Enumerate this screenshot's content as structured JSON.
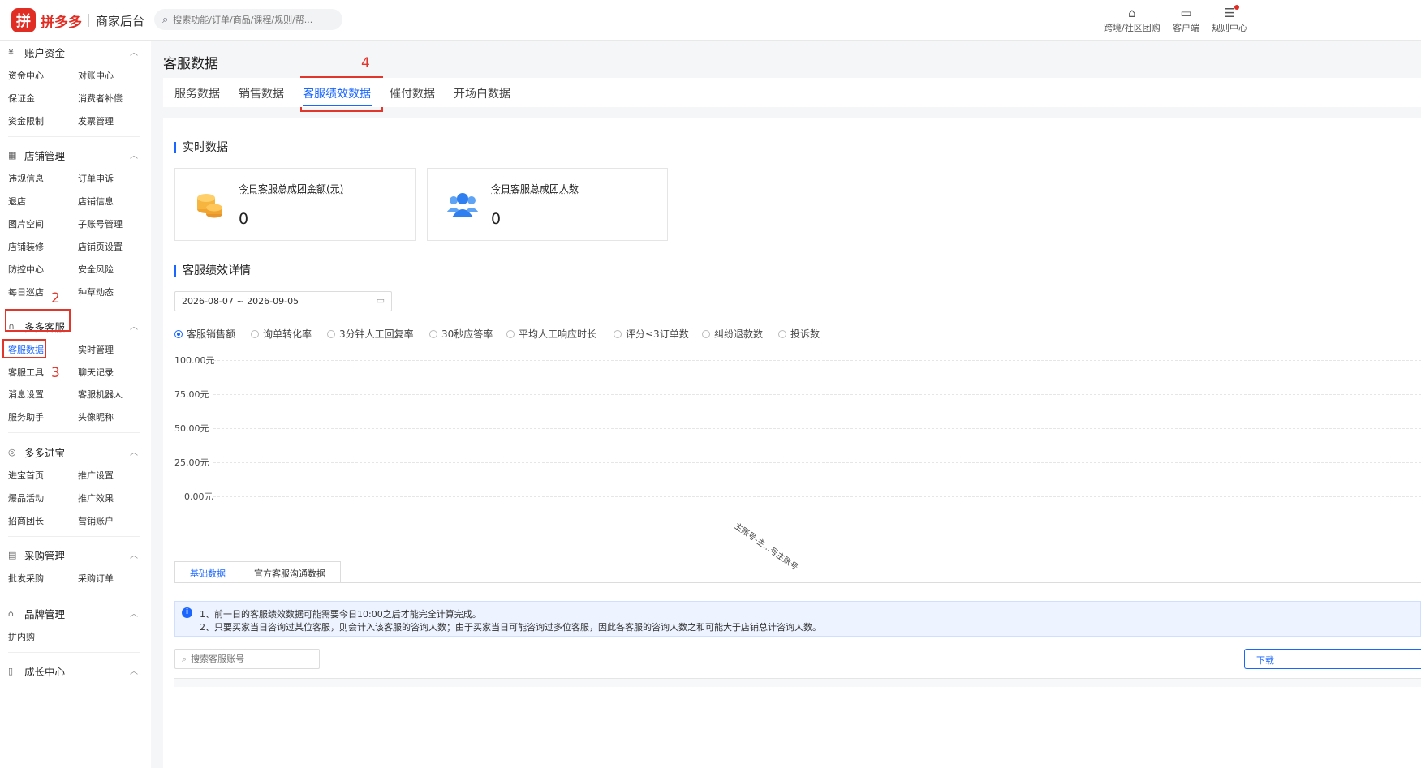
{
  "header": {
    "logo_mark": "拼",
    "logo_text": "拼多多",
    "logo_sub": "商家后台",
    "search_placeholder": "搜索功能/订单/商品/课程/规则/帮...",
    "links": [
      {
        "icon": "store-icon",
        "glyph": "⌂",
        "label": "跨境/社区团购"
      },
      {
        "icon": "client-icon",
        "glyph": "▭",
        "label": "客户端"
      },
      {
        "icon": "rules-icon",
        "glyph": "☰",
        "label": "规则中心"
      }
    ]
  },
  "sidebar": {
    "groups": [
      {
        "title": "账户资金",
        "icon": "¥",
        "items": [
          "资金中心",
          "对账中心",
          "保证金",
          "消费者补偿",
          "资金限制",
          "发票管理"
        ]
      },
      {
        "title": "店铺管理",
        "icon": "▦",
        "items": [
          "违规信息",
          "订单申诉",
          "退店",
          "店铺信息",
          "图片空间",
          "子账号管理",
          "店铺装修",
          "店铺页设置",
          "防控中心",
          "安全风险",
          "每日巡店",
          "种草动态"
        ]
      },
      {
        "title": "多多客服",
        "icon": "∩",
        "items": [
          "客服数据",
          "实时管理",
          "客服工具",
          "聊天记录",
          "消息设置",
          "客服机器人",
          "服务助手",
          "头像昵称"
        ]
      },
      {
        "title": "多多进宝",
        "icon": "◎",
        "items": [
          "进宝首页",
          "推广设置",
          "爆品活动",
          "推广效果",
          "招商团长",
          "营销账户"
        ]
      },
      {
        "title": "采购管理",
        "icon": "▤",
        "items": [
          "批发采购",
          "采购订单"
        ]
      },
      {
        "title": "品牌管理",
        "icon": "⌂",
        "items": [
          "拼内购"
        ]
      },
      {
        "title": "成长中心",
        "icon": "▯",
        "items": []
      }
    ],
    "chevron": "︿"
  },
  "annotations": [
    "2",
    "3",
    "4"
  ],
  "page_title": "客服数据",
  "tabs": [
    "服务数据",
    "销售数据",
    "客服绩效数据",
    "催付数据",
    "开场白数据"
  ],
  "realtime": {
    "title": "实时数据",
    "cards": [
      {
        "label": "今日客服总成团金额(元)",
        "value": "0",
        "icon": "coins-icon"
      },
      {
        "label": "今日客服总成团人数",
        "value": "0",
        "icon": "users-icon"
      }
    ]
  },
  "detail": {
    "title": "客服绩效详情",
    "date_range": "2026-08-07 ~ 2026-09-05",
    "metrics": [
      "客服销售额",
      "询单转化率",
      "3分钟人工回复率",
      "30秒应答率",
      "平均人工响应时长",
      "评分≤3订单数",
      "纠纷退款数",
      "投诉数"
    ],
    "selected_metric": "客服销售额"
  },
  "chart_data": {
    "type": "bar",
    "categories": [
      "主账号-主...号主账号"
    ],
    "values": [
      0
    ],
    "ylim": [
      0,
      100
    ],
    "yticks": [
      "100.00元",
      "75.00元",
      "50.00元",
      "25.00元",
      "0.00元"
    ]
  },
  "subtabs": [
    "基础数据",
    "官方客服沟通数据"
  ],
  "notice": {
    "line1": "1、前一日的客服绩效数据可能需要今日10:00之后才能完全计算完成。",
    "line2": "2、只要买家当日咨询过某位客服，则会计入该客服的咨询人数；由于买家当日可能咨询过多位客服，因此各客服的咨询人数之和可能大于店铺总计咨询人数。"
  },
  "account_search_placeholder": "搜索客服账号",
  "download_label": "下载"
}
